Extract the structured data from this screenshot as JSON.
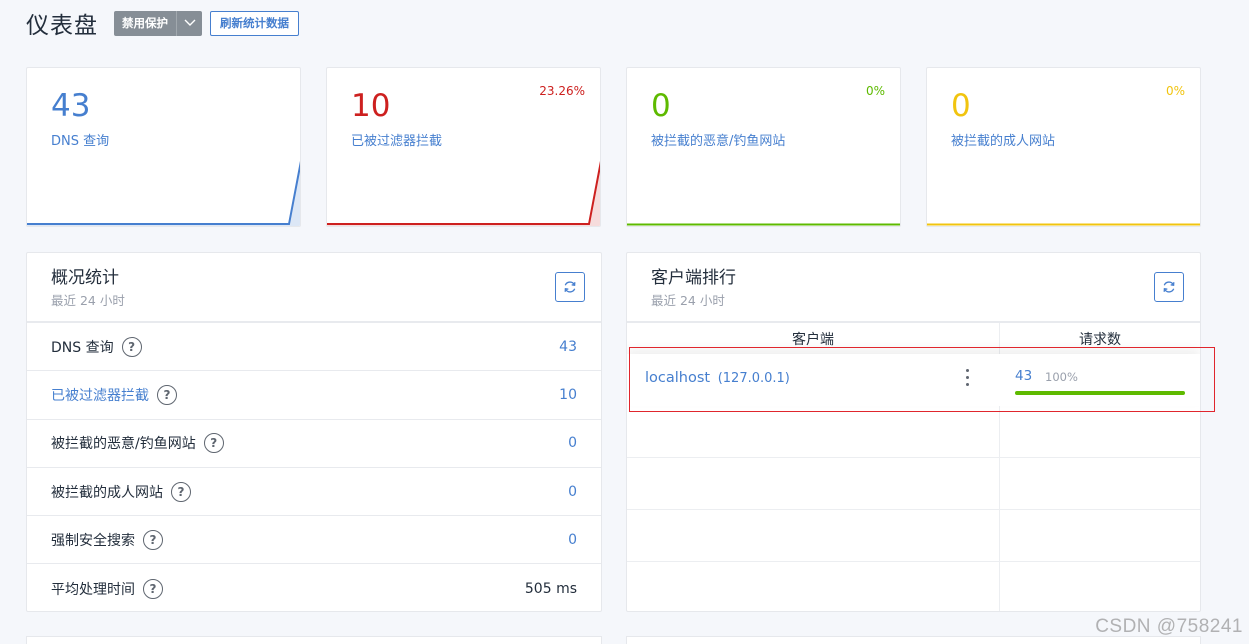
{
  "header": {
    "title": "仪表盘",
    "disable_protection_label": "禁用保护",
    "refresh_stats_label": "刷新统计数据"
  },
  "colors": {
    "blue": "#467fcf",
    "red": "#cd201f",
    "green": "#5eba00",
    "yellow": "#f1c40f"
  },
  "stat_cards": [
    {
      "value": "43",
      "label": "DNS 查询",
      "percent": "",
      "color": "#467fcf"
    },
    {
      "value": "10",
      "label": "已被过滤器拦截",
      "percent": "23.26%",
      "color": "#cd201f"
    },
    {
      "value": "0",
      "label": "被拦截的恶意/钓鱼网站",
      "percent": "0%",
      "color": "#5eba00"
    },
    {
      "value": "0",
      "label": "被拦截的成人网站",
      "percent": "0%",
      "color": "#f1c40f"
    }
  ],
  "overview": {
    "title": "概况统计",
    "subtitle": "最近 24 小时",
    "rows": [
      {
        "label": "DNS 查询",
        "value": "43"
      },
      {
        "label": "已被过滤器拦截",
        "value": "10"
      },
      {
        "label": "被拦截的恶意/钓鱼网站",
        "value": "0"
      },
      {
        "label": "被拦截的成人网站",
        "value": "0"
      },
      {
        "label": "强制安全搜索",
        "value": "0"
      },
      {
        "label": "平均处理时间",
        "value": "505 ms"
      }
    ]
  },
  "clients": {
    "title": "客户端排行",
    "subtitle": "最近 24 小时",
    "columns": [
      "客户端",
      "请求数"
    ],
    "rows": [
      {
        "name": "localhost",
        "ip": "(127.0.0.1)",
        "count": "43",
        "percent": "100%",
        "fraction": 1.0
      }
    ]
  },
  "help_glyph": "?",
  "watermark": "CSDN @758241"
}
